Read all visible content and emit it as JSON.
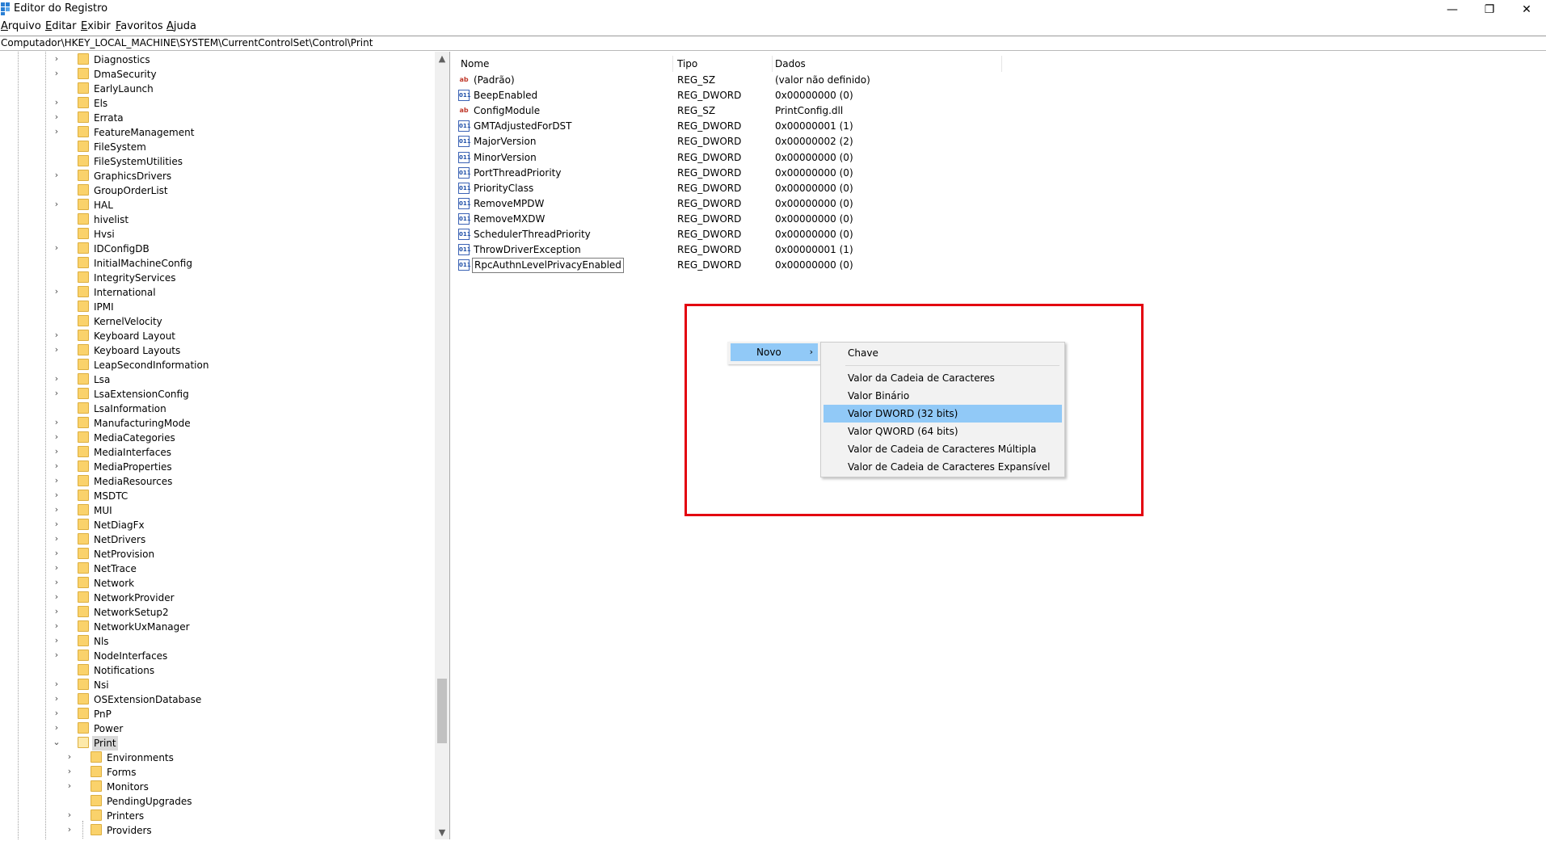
{
  "window": {
    "title": "Editor do Registro",
    "minimize": "—",
    "restore": "❐",
    "close": "✕"
  },
  "menu": [
    {
      "label": "Arquivo"
    },
    {
      "label": "Editar"
    },
    {
      "label": "Exibir"
    },
    {
      "label": "Favoritos"
    },
    {
      "label": "Ajuda"
    }
  ],
  "address": "Computador\\HKEY_LOCAL_MACHINE\\SYSTEM\\CurrentControlSet\\Control\\Print",
  "tree": {
    "items": [
      {
        "label": "Diagnostics",
        "expandable": true
      },
      {
        "label": "DmaSecurity",
        "expandable": true
      },
      {
        "label": "EarlyLaunch",
        "expandable": false
      },
      {
        "label": "Els",
        "expandable": true
      },
      {
        "label": "Errata",
        "expandable": true
      },
      {
        "label": "FeatureManagement",
        "expandable": true
      },
      {
        "label": "FileSystem",
        "expandable": false
      },
      {
        "label": "FileSystemUtilities",
        "expandable": false
      },
      {
        "label": "GraphicsDrivers",
        "expandable": true
      },
      {
        "label": "GroupOrderList",
        "expandable": false
      },
      {
        "label": "HAL",
        "expandable": true
      },
      {
        "label": "hivelist",
        "expandable": false
      },
      {
        "label": "Hvsi",
        "expandable": false
      },
      {
        "label": "IDConfigDB",
        "expandable": true
      },
      {
        "label": "InitialMachineConfig",
        "expandable": false
      },
      {
        "label": "IntegrityServices",
        "expandable": false
      },
      {
        "label": "International",
        "expandable": true
      },
      {
        "label": "IPMI",
        "expandable": false
      },
      {
        "label": "KernelVelocity",
        "expandable": false
      },
      {
        "label": "Keyboard Layout",
        "expandable": true
      },
      {
        "label": "Keyboard Layouts",
        "expandable": true
      },
      {
        "label": "LeapSecondInformation",
        "expandable": false
      },
      {
        "label": "Lsa",
        "expandable": true
      },
      {
        "label": "LsaExtensionConfig",
        "expandable": true
      },
      {
        "label": "LsaInformation",
        "expandable": false
      },
      {
        "label": "ManufacturingMode",
        "expandable": true
      },
      {
        "label": "MediaCategories",
        "expandable": true
      },
      {
        "label": "MediaInterfaces",
        "expandable": true
      },
      {
        "label": "MediaProperties",
        "expandable": true
      },
      {
        "label": "MediaResources",
        "expandable": true
      },
      {
        "label": "MSDTC",
        "expandable": true
      },
      {
        "label": "MUI",
        "expandable": true
      },
      {
        "label": "NetDiagFx",
        "expandable": true
      },
      {
        "label": "NetDrivers",
        "expandable": true
      },
      {
        "label": "NetProvision",
        "expandable": true
      },
      {
        "label": "NetTrace",
        "expandable": true
      },
      {
        "label": "Network",
        "expandable": true
      },
      {
        "label": "NetworkProvider",
        "expandable": true
      },
      {
        "label": "NetworkSetup2",
        "expandable": true
      },
      {
        "label": "NetworkUxManager",
        "expandable": true
      },
      {
        "label": "Nls",
        "expandable": true
      },
      {
        "label": "NodeInterfaces",
        "expandable": true
      },
      {
        "label": "Notifications",
        "expandable": false
      },
      {
        "label": "Nsi",
        "expandable": true
      },
      {
        "label": "OSExtensionDatabase",
        "expandable": true
      },
      {
        "label": "PnP",
        "expandable": true
      },
      {
        "label": "Power",
        "expandable": true
      },
      {
        "label": "Print",
        "expandable": true,
        "expanded": true,
        "selected": true
      },
      {
        "label": "Environments",
        "expandable": true,
        "child": true
      },
      {
        "label": "Forms",
        "expandable": true,
        "child": true
      },
      {
        "label": "Monitors",
        "expandable": true,
        "child": true
      },
      {
        "label": "PendingUpgrades",
        "expandable": false,
        "child": true
      },
      {
        "label": "Printers",
        "expandable": true,
        "child": true
      },
      {
        "label": "Providers",
        "expandable": true,
        "child": true
      }
    ]
  },
  "list": {
    "columns": {
      "name": "Nome",
      "type": "Tipo",
      "data": "Dados"
    },
    "rows": [
      {
        "icon": "string-value-icon",
        "name": "(Padrão)",
        "type": "REG_SZ",
        "data": "(valor não definido)"
      },
      {
        "icon": "dword-value-icon",
        "name": "BeepEnabled",
        "type": "REG_DWORD",
        "data": "0x00000000 (0)"
      },
      {
        "icon": "string-value-icon",
        "name": "ConfigModule",
        "type": "REG_SZ",
        "data": "PrintConfig.dll"
      },
      {
        "icon": "dword-value-icon",
        "name": "GMTAdjustedForDST",
        "type": "REG_DWORD",
        "data": "0x00000001 (1)"
      },
      {
        "icon": "dword-value-icon",
        "name": "MajorVersion",
        "type": "REG_DWORD",
        "data": "0x00000002 (2)"
      },
      {
        "icon": "dword-value-icon",
        "name": "MinorVersion",
        "type": "REG_DWORD",
        "data": "0x00000000 (0)"
      },
      {
        "icon": "dword-value-icon",
        "name": "PortThreadPriority",
        "type": "REG_DWORD",
        "data": "0x00000000 (0)"
      },
      {
        "icon": "dword-value-icon",
        "name": "PriorityClass",
        "type": "REG_DWORD",
        "data": "0x00000000 (0)"
      },
      {
        "icon": "dword-value-icon",
        "name": "RemoveMPDW",
        "type": "REG_DWORD",
        "data": "0x00000000 (0)"
      },
      {
        "icon": "dword-value-icon",
        "name": "RemoveMXDW",
        "type": "REG_DWORD",
        "data": "0x00000000 (0)"
      },
      {
        "icon": "dword-value-icon",
        "name": "SchedulerThreadPriority",
        "type": "REG_DWORD",
        "data": "0x00000000 (0)"
      },
      {
        "icon": "dword-value-icon",
        "name": "ThrowDriverException",
        "type": "REG_DWORD",
        "data": "0x00000001 (1)"
      },
      {
        "icon": "dword-value-icon",
        "name": "RpcAuthnLevelPrivacyEnabled",
        "type": "REG_DWORD",
        "data": "0x00000000 (0)",
        "editing": true
      }
    ]
  },
  "context_menu": {
    "parent_label": "Novo",
    "submenu": [
      {
        "label": "Chave"
      },
      {
        "label": "Valor da Cadeia de Caracteres"
      },
      {
        "label": "Valor Binário"
      },
      {
        "label": "Valor DWORD (32 bits)",
        "highlighted": true
      },
      {
        "label": "Valor QWORD (64 bits)"
      },
      {
        "label": "Valor de Cadeia de Caracteres Múltipla"
      },
      {
        "label": "Valor de Cadeia de Caracteres Expansível"
      }
    ]
  },
  "icons": {
    "sz_glyph": "ab",
    "dword_glyph": "011"
  },
  "colors": {
    "highlight_box": "#e3000f",
    "menu_highlight": "#91c9f7",
    "folder": "#fad26b"
  }
}
